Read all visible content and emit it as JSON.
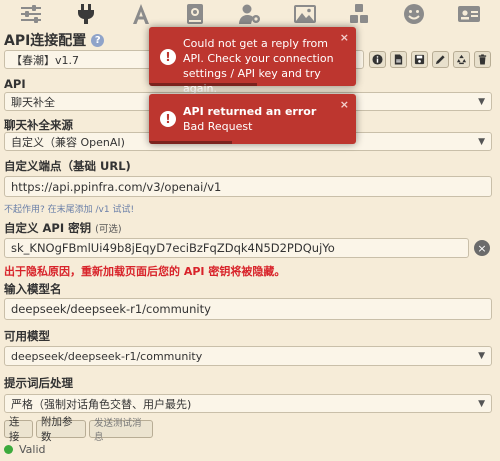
{
  "colors": {
    "background": "#f6ecd8",
    "accent_error": "#bd362f",
    "warning_text": "#d8232a",
    "status_ok": "#3caa3c",
    "icon_gray": "#8b8b8b"
  },
  "topbar": {
    "icons": [
      "sliders-icon",
      "plug-icon",
      "font-icon",
      "book-icon",
      "user-gear-icon",
      "image-icon",
      "cubes-icon",
      "smiley-icon",
      "id-card-icon"
    ],
    "active": "plug-icon"
  },
  "title": "API连接配置",
  "help_glyph": "?",
  "profile_select": {
    "value": "【春潮】v1.7"
  },
  "profile_tools": [
    "info-icon",
    "file-icon",
    "save-icon",
    "pencil-icon",
    "recycle-icon",
    "trash-icon"
  ],
  "api": {
    "label": "API",
    "value": "聊天补全"
  },
  "source": {
    "label": "聊天补全来源",
    "value": "自定义（兼容 OpenAI)"
  },
  "endpoint": {
    "label": "自定义端点（基础 URL)",
    "value": "https://api.ppinfra.com/v3/openai/v1",
    "hint": "不起作用? 在末尾添加 /v1 试试!"
  },
  "api_key": {
    "label": "自定义 API 密钥",
    "label_note": "(可选)",
    "value": "sk_KNOgFBmlUi49b8jEqyD7eciBzFqZDqk4N5D2PDQujYo",
    "clear_glyph": "×",
    "warning": "出于隐私原因，重新加载页面后您的 API 密钥将被隐藏。"
  },
  "model_input": {
    "label": "输入模型名",
    "value": "deepseek/deepseek-r1/community"
  },
  "available_models": {
    "label": "可用模型",
    "value": "deepseek/deepseek-r1/community"
  },
  "postprocess": {
    "label": "提示词后处理",
    "value": "严格（强制对话角色交替、用户最先)"
  },
  "buttons": {
    "connect": "连接",
    "extra_params": "附加参数",
    "send_test": "发送测试消息"
  },
  "status": {
    "text": "Valid"
  },
  "toasts": [
    {
      "title": "",
      "message": "Could not get a reply from API. Check your connection settings / API key and try again.",
      "close": "×",
      "progress": 0.52
    },
    {
      "title": "API returned an error",
      "message": "Bad Request",
      "close": "×",
      "progress": 0.4
    }
  ]
}
